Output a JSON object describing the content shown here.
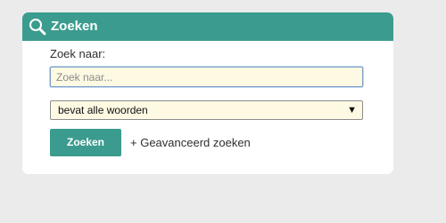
{
  "panel": {
    "title": "Zoeken",
    "icon": "search-icon"
  },
  "form": {
    "label": "Zoek naar:",
    "input_value": "",
    "input_placeholder": "Zoek naar...",
    "match_select": {
      "selected": "bevat alle woorden",
      "arrow": "▼"
    },
    "submit_label": "Zoeken",
    "advanced_link": "+ Geavanceerd zoeken"
  },
  "colors": {
    "accent": "#3b9b8e",
    "field_background": "#fdf9e2",
    "page_background": "#ebebeb"
  }
}
